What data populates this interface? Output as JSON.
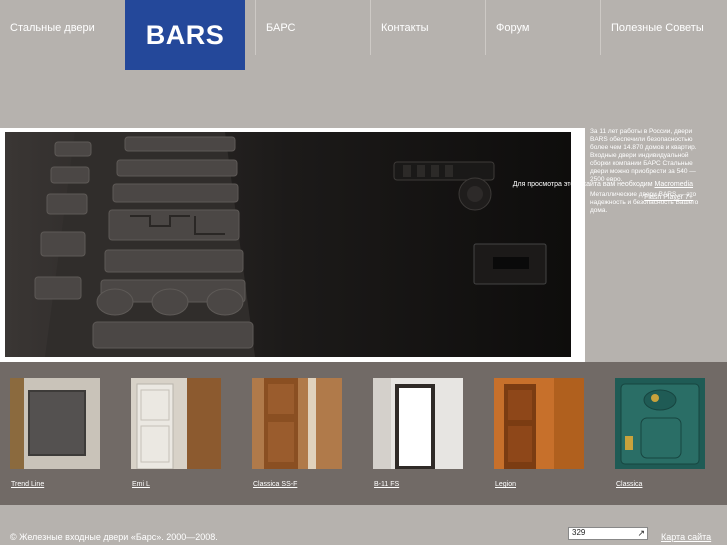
{
  "nav": {
    "items": [
      {
        "label": "Стальные двери"
      },
      {
        "label": "БАРС"
      },
      {
        "label": "Контакты"
      },
      {
        "label": "Форум"
      },
      {
        "label": "Полезные Советы"
      }
    ],
    "logo_text": "BARS",
    "logo_color": "#24489a"
  },
  "hero": {
    "flash_line1": "Для просмотра этого сайта вам необходим",
    "flash_link1": "Macromedia",
    "flash_link2": "Flash Player 7+"
  },
  "side": {
    "para1": "За 11 лет работы в России, двери BARS обеспечили безопасностью более чем 14.870 домов и квартир. Входные двери индивидуальной сборки компании БАРС Стальные двери можно приобрести за 540 — 2500 евро.",
    "para2": "Металлические двери BARS — это надежность и безопасность Вашего дома."
  },
  "thumbs": [
    {
      "label": "Trend Line"
    },
    {
      "label": "Emi L"
    },
    {
      "label": "Classica SS-F"
    },
    {
      "label": "B-11 FS"
    },
    {
      "label": "Legion"
    },
    {
      "label": "Classica"
    }
  ],
  "footer": {
    "copyright": "© Железные входные двери «Барс». 2000—2008.",
    "counter": "329",
    "sitemap": "Карта сайта"
  }
}
